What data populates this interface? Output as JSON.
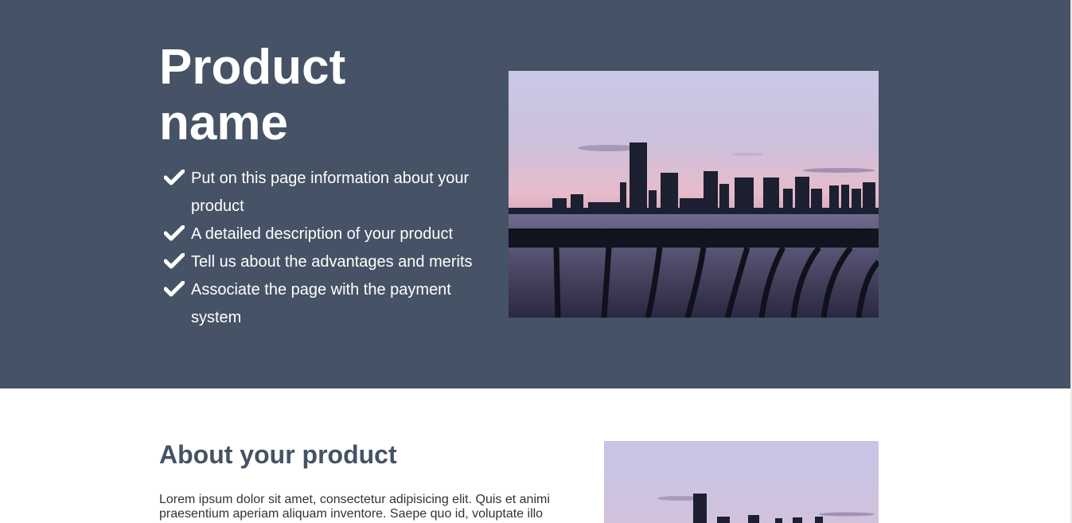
{
  "hero": {
    "title_line1": "Product",
    "title_line2": "name",
    "features": [
      "Put on this page information about your product",
      "A detailed description of your product",
      "Tell us about the advantages and merits",
      "Associate the page with the payment system"
    ],
    "background_color": "#465265",
    "check_icon": "checkmark-icon"
  },
  "about": {
    "title": "About your product",
    "text": "Lorem ipsum dolor sit amet, consectetur adipisicing elit. Quis et animi praesentium aperiam aliquam inventore. Saepe quo id, voluptate illo",
    "title_color": "#465265"
  }
}
